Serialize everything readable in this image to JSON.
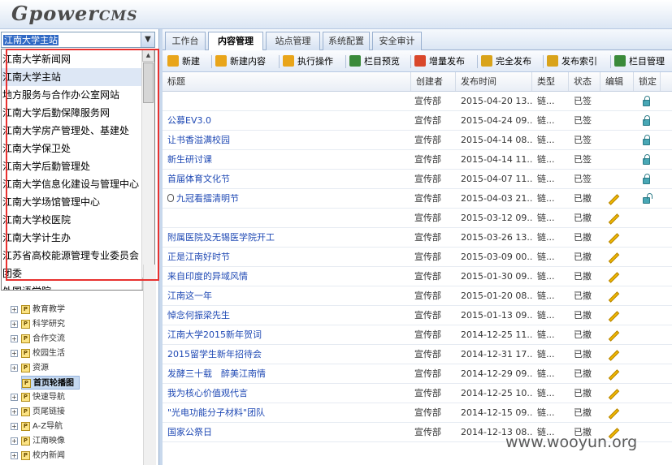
{
  "logo": {
    "main": "Gpower",
    "suffix": "CMS"
  },
  "site_select": {
    "value": "江南大学主站",
    "options": [
      {
        "label": "江南大学新闻网",
        "selected": false
      },
      {
        "label": "江南大学主站",
        "selected": true
      },
      {
        "label": "地方服务与合作办公室网站",
        "selected": false
      },
      {
        "label": "江南大学后勤保障服务网",
        "selected": false
      },
      {
        "label": "江南大学房产管理处、基建处",
        "selected": false
      },
      {
        "label": "江南大学保卫处",
        "selected": false
      },
      {
        "label": "江南大学后勤管理处",
        "selected": false
      },
      {
        "label": "江南大学信息化建设与管理中心",
        "selected": false
      },
      {
        "label": "江南大学场馆管理中心",
        "selected": false
      },
      {
        "label": "江南大学校医院",
        "selected": false
      },
      {
        "label": "江南大学计生办",
        "selected": false
      },
      {
        "label": "江苏省高校能源管理专业委员会",
        "selected": false
      },
      {
        "label": "团委",
        "selected": false
      },
      {
        "label": "外国语学院",
        "selected": false
      }
    ]
  },
  "tree": {
    "items": [
      {
        "label": "教育教学",
        "expander": "+",
        "icon": "P"
      },
      {
        "label": "科学研究",
        "expander": "+",
        "icon": "P"
      },
      {
        "label": "合作交流",
        "expander": "+",
        "icon": "P"
      },
      {
        "label": "校园生活",
        "expander": "+",
        "icon": "P"
      },
      {
        "label": "资源",
        "expander": "+",
        "icon": "P"
      },
      {
        "label": "首页轮播图",
        "expander": "",
        "icon": "P",
        "selected": true
      },
      {
        "label": "快速导航",
        "expander": "+",
        "icon": "P"
      },
      {
        "label": "页尾链接",
        "expander": "+",
        "icon": "P"
      },
      {
        "label": "A-Z导航",
        "expander": "+",
        "icon": "P"
      },
      {
        "label": "江南映像",
        "expander": "+",
        "icon": "P"
      },
      {
        "label": "校内新闻",
        "expander": "+",
        "icon": "P"
      }
    ]
  },
  "tabs": [
    {
      "label": "工作台",
      "active": false
    },
    {
      "label": "内容管理",
      "active": true
    },
    {
      "label": "站点管理",
      "active": false
    },
    {
      "label": "系统配置",
      "active": false
    },
    {
      "label": "安全审计",
      "active": false
    }
  ],
  "toolbar": {
    "items": [
      {
        "label": "新建",
        "icon": "new-icon",
        "color": "#e9a51a"
      },
      {
        "label": "新建内容",
        "icon": "new-content-icon",
        "color": "#e9a51a"
      },
      {
        "label": "执行操作",
        "icon": "execute-icon",
        "color": "#e9a51a"
      },
      {
        "label": "栏目预览",
        "icon": "preview-icon",
        "color": "#3a8a3a"
      },
      {
        "label": "增量发布",
        "icon": "incremental-publish-icon",
        "color": "#d9472b"
      },
      {
        "label": "完全发布",
        "icon": "full-publish-icon",
        "color": "#d9a31a"
      },
      {
        "label": "发布索引",
        "icon": "publish-index-icon",
        "color": "#d9a31a"
      },
      {
        "label": "栏目管理",
        "icon": "column-manage-icon",
        "color": "#3a8a3a"
      }
    ]
  },
  "grid": {
    "columns": [
      "标题",
      "创建者",
      "发布时间",
      "类型",
      "状态",
      "编辑",
      "锁定"
    ],
    "rows": [
      {
        "title": "",
        "creator": "宣传部",
        "time": "2015-04-20 13...",
        "type": "链...",
        "status": "已签",
        "editable": false,
        "lock": "closed"
      },
      {
        "title": "公募EV3.0",
        "creator": "宣传部",
        "time": "2015-04-24 09...",
        "type": "链...",
        "status": "已签",
        "editable": false,
        "lock": "closed"
      },
      {
        "title": "让书香溢满校园",
        "creator": "宣传部",
        "time": "2015-04-14 08...",
        "type": "链...",
        "status": "已签",
        "editable": false,
        "lock": "closed"
      },
      {
        "title": "新生研讨课",
        "creator": "宣传部",
        "time": "2015-04-14 11...",
        "type": "链...",
        "status": "已签",
        "editable": false,
        "lock": "closed"
      },
      {
        "title": "首届体育文化节",
        "creator": "宣传部",
        "time": "2015-04-07 11...",
        "type": "链...",
        "status": "已签",
        "editable": false,
        "lock": "closed"
      },
      {
        "title": "九冠看擂清明节",
        "creator": "宣传部",
        "time": "2015-04-03 21...",
        "type": "链...",
        "status": "已撤",
        "editable": true,
        "lock": "open",
        "mouse": true
      },
      {
        "title": "",
        "creator": "宣传部",
        "time": "2015-03-12 09...",
        "type": "链...",
        "status": "已撤",
        "editable": true,
        "lock": "none"
      },
      {
        "title": "附属医院及无锡医学院开工",
        "creator": "宣传部",
        "time": "2015-03-26 13...",
        "type": "链...",
        "status": "已撤",
        "editable": true,
        "lock": "none"
      },
      {
        "title": "正是江南好时节",
        "creator": "宣传部",
        "time": "2015-03-09 00...",
        "type": "链...",
        "status": "已撤",
        "editable": true,
        "lock": "none"
      },
      {
        "title": "来自印度的异域风情",
        "creator": "宣传部",
        "time": "2015-01-30 09...",
        "type": "链...",
        "status": "已撤",
        "editable": true,
        "lock": "none"
      },
      {
        "title": "江南这一年",
        "creator": "宣传部",
        "time": "2015-01-20 08...",
        "type": "链...",
        "status": "已撤",
        "editable": true,
        "lock": "none"
      },
      {
        "title": "悼念何振梁先生",
        "creator": "宣传部",
        "time": "2015-01-13 09...",
        "type": "链...",
        "status": "已撤",
        "editable": true,
        "lock": "none"
      },
      {
        "title": "江南大学2015新年贺词",
        "creator": "宣传部",
        "time": "2014-12-25 11...",
        "type": "链...",
        "status": "已撤",
        "editable": true,
        "lock": "none"
      },
      {
        "title": "2015留学生新年招待会",
        "creator": "宣传部",
        "time": "2014-12-31 17...",
        "type": "链...",
        "status": "已撤",
        "editable": true,
        "lock": "none"
      },
      {
        "title": "发酵三十载　醉美江南情",
        "creator": "宣传部",
        "time": "2014-12-29 09...",
        "type": "链...",
        "status": "已撤",
        "editable": true,
        "lock": "none"
      },
      {
        "title": "我为核心价值观代言",
        "creator": "宣传部",
        "time": "2014-12-25 10...",
        "type": "链...",
        "status": "已撤",
        "editable": true,
        "lock": "none"
      },
      {
        "title": "\"光电功能分子材料\"团队",
        "creator": "宣传部",
        "time": "2014-12-15 09...",
        "type": "链...",
        "status": "已撤",
        "editable": true,
        "lock": "none"
      },
      {
        "title": "国家公祭日",
        "creator": "宣传部",
        "time": "2014-12-13 08...",
        "type": "链...",
        "status": "已撤",
        "editable": true,
        "lock": "none"
      }
    ]
  },
  "watermark": "www.wooyun.org"
}
